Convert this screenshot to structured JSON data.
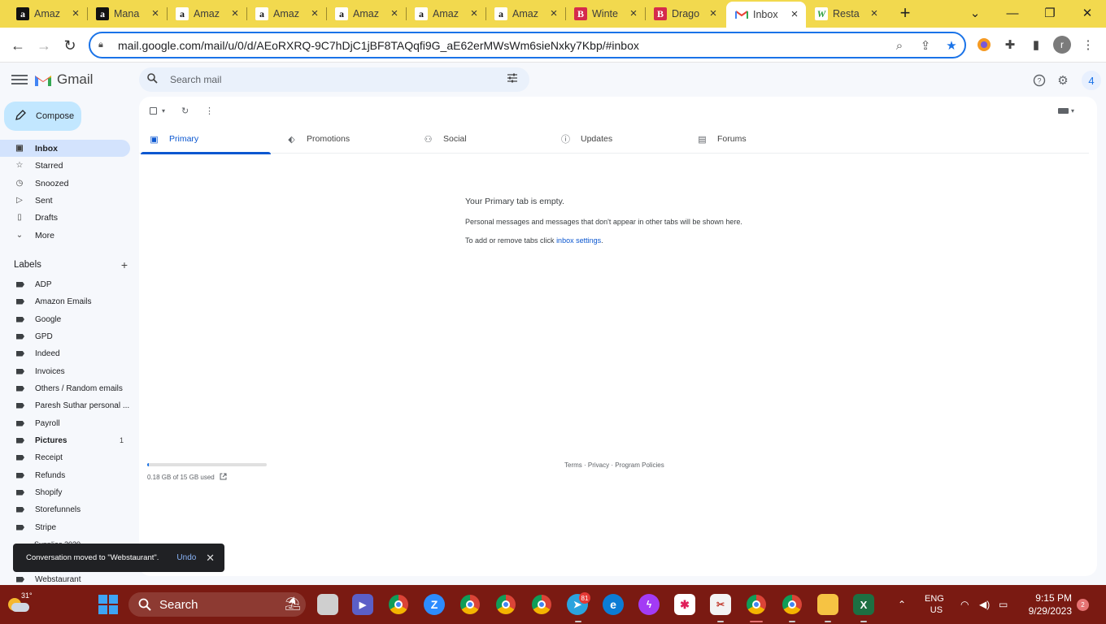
{
  "browser": {
    "tabs": [
      {
        "title": "Amaz",
        "favicon": "amazon-black"
      },
      {
        "title": "Mana",
        "favicon": "amazon-black"
      },
      {
        "title": "Amaz",
        "favicon": "amazon-white"
      },
      {
        "title": "Amaz",
        "favicon": "amazon-white"
      },
      {
        "title": "Amaz",
        "favicon": "amazon-white"
      },
      {
        "title": "Amaz",
        "favicon": "amazon-white"
      },
      {
        "title": "Amaz",
        "favicon": "amazon-white"
      },
      {
        "title": "Winte",
        "favicon": "b-red"
      },
      {
        "title": "Drago",
        "favicon": "b-red"
      },
      {
        "title": "Inbox",
        "favicon": "gmail"
      },
      {
        "title": "Resta",
        "favicon": "w-green"
      }
    ],
    "url": "mail.google.com/mail/u/0/d/AEoRXRQ-9C7hDjC1jBF8TAQqfi9G_aE62erMWsWm6sieNxky7Kbp/#inbox",
    "profile_initial": "r"
  },
  "gmail": {
    "app_name": "Gmail",
    "search_placeholder": "Search mail",
    "account_initial": "4",
    "compose_label": "Compose",
    "nav": [
      {
        "label": "Inbox",
        "icon": "inbox-icon"
      },
      {
        "label": "Starred",
        "icon": "star-icon"
      },
      {
        "label": "Snoozed",
        "icon": "clock-icon"
      },
      {
        "label": "Sent",
        "icon": "send-icon"
      },
      {
        "label": "Drafts",
        "icon": "draft-icon"
      },
      {
        "label": "More",
        "icon": "chevron-down-icon"
      }
    ],
    "labels_heading": "Labels",
    "labels": [
      {
        "name": "ADP"
      },
      {
        "name": "Amazon Emails"
      },
      {
        "name": "Google"
      },
      {
        "name": "GPD"
      },
      {
        "name": "Indeed"
      },
      {
        "name": "Invoices"
      },
      {
        "name": "Others / Random emails"
      },
      {
        "name": "Paresh Suthar personal ..."
      },
      {
        "name": "Payroll"
      },
      {
        "name": "Pictures",
        "count": "1"
      },
      {
        "name": "Receipt"
      },
      {
        "name": "Refunds"
      },
      {
        "name": "Shopify"
      },
      {
        "name": "Storefunnels"
      },
      {
        "name": "Stripe"
      }
    ],
    "partial_label": "Supplies 2020",
    "bottom_label": "Webstaurant",
    "category_tabs": [
      "Primary",
      "Promotions",
      "Social",
      "Updates",
      "Forums"
    ],
    "empty_state": {
      "title": "Your Primary tab is empty.",
      "line1": "Personal messages and messages that don't appear in other tabs will be shown here.",
      "line2_prefix": "To add or remove tabs click ",
      "line2_link": "inbox settings",
      "line2_suffix": "."
    },
    "storage": {
      "text": "0.18 GB of 15 GB used",
      "fraction": 0.012
    },
    "footer": "Terms · Privacy · Program Policies",
    "snackbar": {
      "message": "Conversation moved to \"Webstaurant\".",
      "action": "Undo"
    }
  },
  "taskbar": {
    "weather": "31°",
    "search_label": "Search",
    "telegram_badge": "81",
    "language_primary": "ENG",
    "language_secondary": "US",
    "time": "9:15 PM",
    "date": "9/29/2023",
    "notification_count": "2"
  }
}
